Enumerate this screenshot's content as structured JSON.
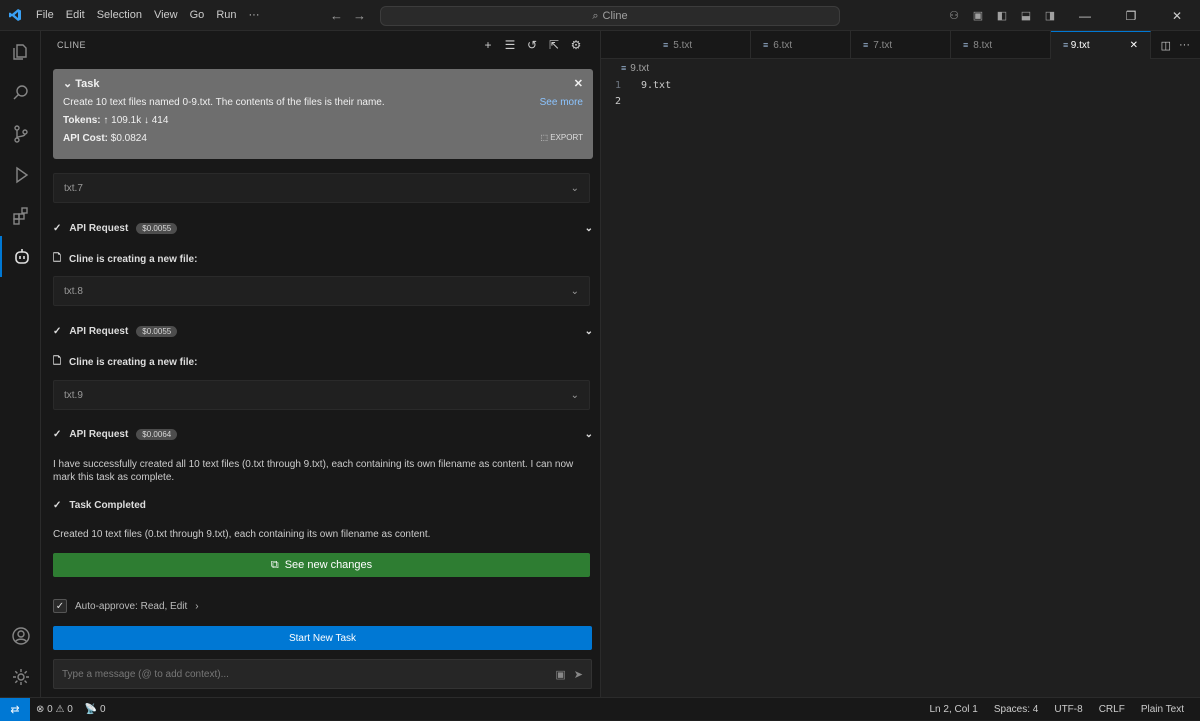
{
  "titlebar": {
    "menu": [
      "File",
      "Edit",
      "Selection",
      "View",
      "Go",
      "Run",
      "···"
    ],
    "search": "Cline"
  },
  "sidebar": {
    "title": "CLINE",
    "task": {
      "heading": "Task",
      "description": "Create 10 text files named 0-9.txt. The contents of the files is their name.",
      "see_more": "See more",
      "tokens_label": "Tokens:",
      "tokens_value": "↑ 109.1k ↓ 414",
      "cost_label": "API Cost:",
      "cost_value": "$0.0824",
      "export": "EXPORT"
    },
    "file_rows": [
      "txt.7",
      "txt.8",
      "txt.9"
    ],
    "requests": [
      {
        "label": "API Request",
        "cost": "$0.0055"
      },
      {
        "label": "API Request",
        "cost": "$0.0055"
      },
      {
        "label": "API Request",
        "cost": "$0.0064"
      }
    ],
    "creating_label": "Cline is creating a new file:",
    "final_message": "I have successfully created all 10 text files (0.txt through 9.txt), each containing its own filename as content. I can now mark this task as complete.",
    "task_completed": "Task Completed",
    "result": "Created 10 text files (0.txt through 9.txt), each containing its own filename as content.",
    "see_changes": "See new changes",
    "auto_approve": "Auto-approve: Read, Edit",
    "start_new_task": "Start New Task",
    "input_placeholder": "Type a message (@ to add context)..."
  },
  "editor": {
    "tabs": [
      "5.txt",
      "6.txt",
      "7.txt",
      "8.txt",
      "9.txt"
    ],
    "active_tab": "9.txt",
    "breadcrumb": "9.txt",
    "lines": [
      {
        "num": "1",
        "text": "9.txt"
      },
      {
        "num": "2",
        "text": ""
      }
    ]
  },
  "statusbar": {
    "problems": "⊗ 0 ⚠ 0",
    "ports": "📡 0",
    "position": "Ln 2, Col 1",
    "spaces": "Spaces: 4",
    "encoding": "UTF-8",
    "eol": "CRLF",
    "language": "Plain Text"
  },
  "colors": {
    "accent": "#0078d4",
    "success": "#2e7d32",
    "task_bg": "#6e6e6e"
  }
}
